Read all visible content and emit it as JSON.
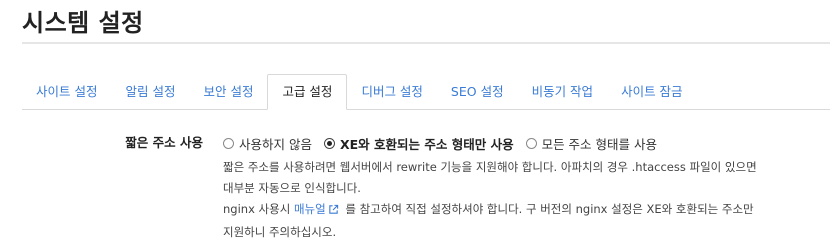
{
  "page": {
    "title": "시스템 설정"
  },
  "tabs": [
    {
      "label": "사이트 설정",
      "active": false
    },
    {
      "label": "알림 설정",
      "active": false
    },
    {
      "label": "보안 설정",
      "active": false
    },
    {
      "label": "고급 설정",
      "active": true
    },
    {
      "label": "디버그 설정",
      "active": false
    },
    {
      "label": "SEO 설정",
      "active": false
    },
    {
      "label": "비동기 작업",
      "active": false
    },
    {
      "label": "사이트 잠금",
      "active": false
    }
  ],
  "short_url": {
    "label": "짧은 주소 사용",
    "options": [
      {
        "label": "사용하지 않음",
        "selected": false
      },
      {
        "label": "XE와 호환되는 주소 형태만 사용",
        "selected": true
      },
      {
        "label": "모든 주소 형태를 사용",
        "selected": false
      }
    ],
    "help_line1": "짧은 주소를 사용하려면 웹서버에서 rewrite 기능을 지원해야 합니다. 아파치의 경우 .htaccess 파일이 있으면",
    "help_line2": "대부분 자동으로 인식합니다.",
    "help_line3_prefix": "nginx 사용시",
    "help_line3_link": "매뉴얼",
    "help_line3_suffix": "를 참고하여 직접 설정하셔야 합니다. 구 버전의 nginx 설정은 XE와 호환되는 주소만",
    "help_line4": "지원하니 주의하십시오.",
    "link_icon": "external-link-icon"
  },
  "colors": {
    "link": "#3a7bd5",
    "text": "#333333",
    "heading": "#222222",
    "border": "#d9d9d9"
  }
}
